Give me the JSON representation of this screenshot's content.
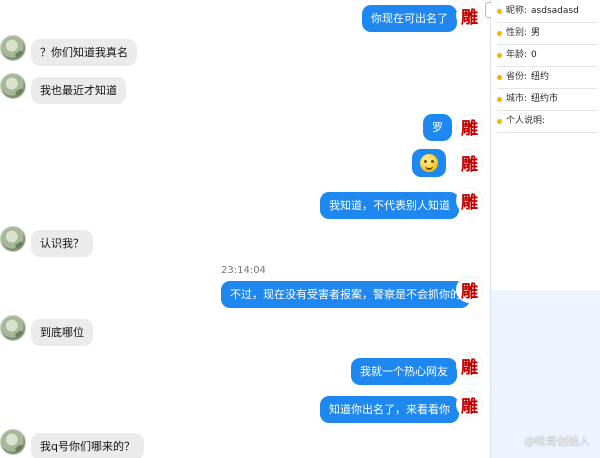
{
  "chat": {
    "timestamp": "23:14:04",
    "messages": [
      {
        "side": "out",
        "text": "你现在可出名了"
      },
      {
        "side": "in",
        "text": "？你们知道我真名"
      },
      {
        "side": "in",
        "text": "我也最近才知道"
      },
      {
        "side": "out",
        "text": "罗"
      },
      {
        "side": "out",
        "text": "",
        "emoji": "smile-emoji"
      },
      {
        "side": "out",
        "text": "我知道，不代表别人知道"
      },
      {
        "side": "in",
        "text": "认识我？"
      },
      {
        "side": "out",
        "text": "不过，现在没有受害者报案，警察是不会抓你的"
      },
      {
        "side": "in",
        "text": "到底哪位"
      },
      {
        "side": "out",
        "text": "我就一个热心网友"
      },
      {
        "side": "out",
        "text": "知道你出名了，来看看你"
      },
      {
        "side": "in",
        "text": "我q号你们哪来的？"
      }
    ]
  },
  "avatar_right_char": "雕",
  "profile": {
    "fields": [
      {
        "label": "昵称:",
        "value": "asdsadasd"
      },
      {
        "label": "性别:",
        "value": "男"
      },
      {
        "label": "年龄:",
        "value": "0"
      },
      {
        "label": "省份:",
        "value": "纽约"
      },
      {
        "label": "城市:",
        "value": "纽约市"
      },
      {
        "label": "个人说明:",
        "value": ""
      }
    ]
  },
  "watermark": "@哇哥创始人",
  "scroll_arrow": "‹",
  "colors": {
    "out_bubble": "#1e88f0",
    "in_bubble": "#ebebeb",
    "accent": "#f2b600"
  }
}
